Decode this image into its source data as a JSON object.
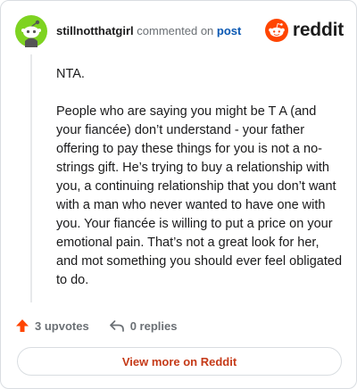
{
  "comment": {
    "author": "stillnotthatgirl",
    "action_text": "commented on",
    "post_link_text": "post",
    "paragraphs": [
      "NTA.",
      "People who are saying you might be T A (and your fiancée) don’t understand - your father offering to pay these things for you is not a no-strings gift. He’s trying to buy a relationship with you, a continuing relationship that you don’t want with a man who never wanted to have one with you. Your fiancée is willing to put a price on your emotional pain. That’s not a great look for her, and mot something you should ever feel obligated to do."
    ]
  },
  "brand": {
    "name": "reddit",
    "accent_color": "#ff4500"
  },
  "actions": {
    "upvotes_label": "3 upvotes",
    "replies_label": "0 replies",
    "upvote_icon": "upvote-arrow-icon",
    "reply_icon": "reply-arrow-icon"
  },
  "footer": {
    "view_more_label": "View more on Reddit"
  }
}
